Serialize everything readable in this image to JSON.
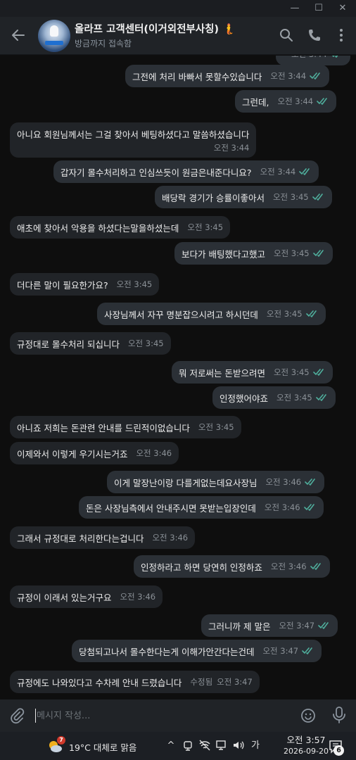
{
  "window": {
    "minimize_label": "—",
    "maximize_label": "☐",
    "close_label": "✕"
  },
  "header": {
    "title": "올라프 고객센터(이거외전부사칭) 🧜",
    "status": "방금까지 접속함"
  },
  "messages": [
    {
      "dir": "out",
      "text": "",
      "time": "오전 3:44",
      "read": true
    },
    {
      "dir": "out",
      "text": "그전에 처리 바빠서 못할수있습니다",
      "time": "오전 3:44",
      "read": true
    },
    {
      "dir": "out",
      "text": "그런데,",
      "time": "오전 3:44",
      "read": true
    },
    {
      "dir": "in",
      "text": "아니요 회원님께서는 그걸 찾아서 베팅하셨다고 말씀하셨습니다",
      "time": "오전 3:44"
    },
    {
      "dir": "out",
      "text": "갑자기 몰수처리하고 인심쓰듯이 원금은내준다니요?",
      "time": "오전 3:44",
      "read": true
    },
    {
      "dir": "out",
      "text": "배당락 경기가 승률이좋아서",
      "time": "오전 3:45",
      "read": true
    },
    {
      "dir": "in",
      "text": "애초에 찾아서 악용을 하셨다는말을하셨는데",
      "time": "오전 3:45"
    },
    {
      "dir": "out",
      "text": "보다가 배팅했다고했고",
      "time": "오전 3:45",
      "read": true
    },
    {
      "dir": "in",
      "text": "더다른 말이 필요한가요?",
      "time": "오전 3:45"
    },
    {
      "dir": "out",
      "text": "사장님께서 자꾸 명분잡으시려고 하시던데",
      "time": "오전 3:45",
      "read": true
    },
    {
      "dir": "in",
      "text": "규정대로 몰수처리 되십니다",
      "time": "오전 3:45"
    },
    {
      "dir": "out",
      "text": "뭐 저로써는 돈받으려면",
      "time": "오전 3:45",
      "read": true
    },
    {
      "dir": "out",
      "text": "인정했어야죠",
      "time": "오전 3:45",
      "read": true
    },
    {
      "dir": "in",
      "text": "아니죠 저희는 돈관련 안내를 드린적이없습니다",
      "time": "오전 3:45"
    },
    {
      "dir": "in",
      "text": "이제와서 이렇게 우기시는거죠",
      "time": "오전 3:46"
    },
    {
      "dir": "out",
      "text": "이게 말장난이랑 다를게없는데요사장님",
      "time": "오전 3:46",
      "read": true
    },
    {
      "dir": "out",
      "text": "돈은 사장님측에서 안내주시면 못받는입장인데",
      "time": "오전 3:46",
      "read": true
    },
    {
      "dir": "in",
      "text": "그래서 규정대로 처리한다는겁니다",
      "time": "오전 3:46"
    },
    {
      "dir": "out",
      "text": "인정하라고 하면 당연히 인정하죠",
      "time": "오전 3:46",
      "read": true
    },
    {
      "dir": "in",
      "text": "규정이 이래서 있는거구요",
      "time": "오전 3:46"
    },
    {
      "dir": "out",
      "text": "그러니까 제 말은",
      "time": "오전 3:47",
      "read": true
    },
    {
      "dir": "out",
      "text": "당첨되고나서 몰수한다는게 이해가안간다는건데",
      "time": "오전 3:47",
      "read": true
    },
    {
      "dir": "in",
      "text": "규정에도 나와있다고 수차례 안내 드렸습니다",
      "time": "오전 3:47",
      "edited": "수정됨"
    }
  ],
  "composer": {
    "placeholder": "메시지 작성..."
  },
  "taskbar": {
    "weather_badge": "7",
    "weather": "19°C  대체로 맑음",
    "tray_chevron": "^",
    "ime": "가",
    "time": "오전 3:57",
    "date": "2026-09-20",
    "notification_count": "6"
  },
  "colors": {
    "background": "#0e0e0e",
    "incoming_bubble": "#212428",
    "outgoing_bubble": "#2b3036",
    "read_check": "#4fae9c",
    "header": "#202327"
  }
}
